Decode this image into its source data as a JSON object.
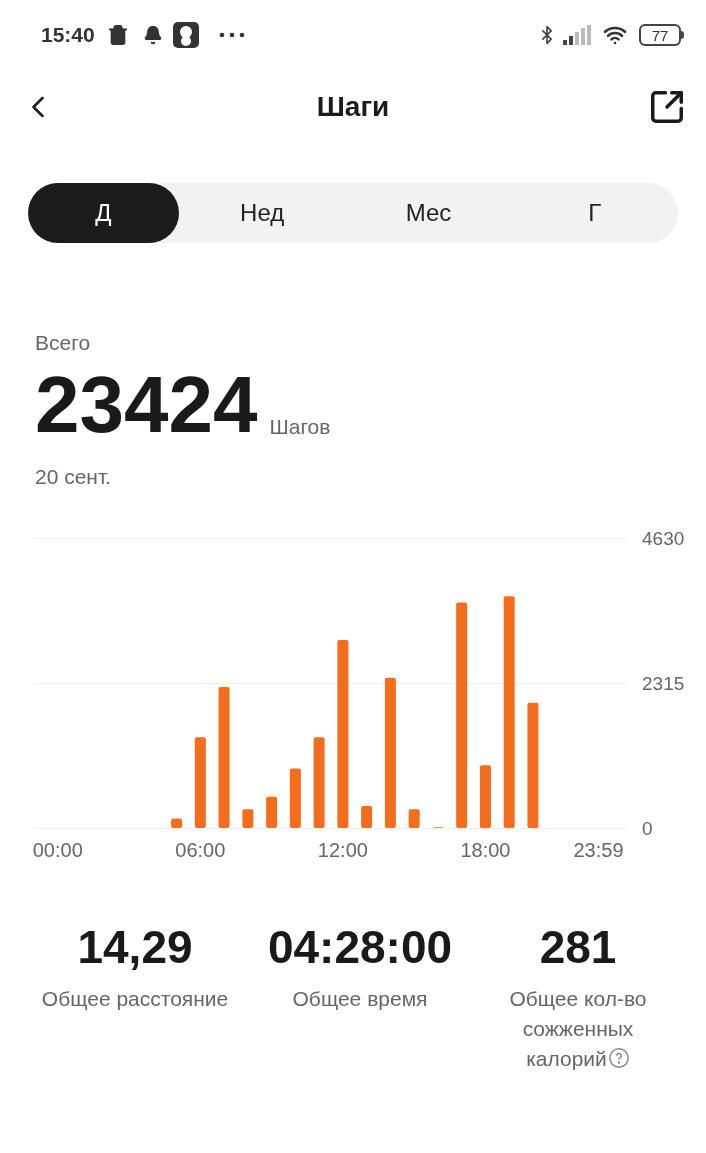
{
  "status_bar": {
    "time": "15:40",
    "battery": "77"
  },
  "header": {
    "title": "Шаги"
  },
  "tabs": [
    {
      "label": "Д",
      "selected": true
    },
    {
      "label": "Нед",
      "selected": false
    },
    {
      "label": "Мес",
      "selected": false
    },
    {
      "label": "Г",
      "selected": false
    }
  ],
  "summary": {
    "label": "Всего",
    "value": "23424",
    "unit": "Шагов",
    "date": "20 сент."
  },
  "chart": {
    "chart_data": {
      "type": "bar",
      "x": [
        5,
        6,
        7,
        8,
        9,
        10,
        11,
        12,
        13,
        14,
        15,
        16,
        17,
        18,
        19,
        20
      ],
      "xlim": [
        -1,
        24
      ],
      "series": [
        {
          "color": "#f36d1c",
          "values": [
            150,
            1450,
            2250,
            300,
            500,
            950,
            1450,
            3000,
            350,
            2400,
            300,
            10,
            3600,
            1000,
            3700,
            2000
          ]
        }
      ],
      "ylim": [
        0,
        4630
      ],
      "yticks": [
        0,
        2315,
        4630
      ],
      "xticks": [
        {
          "value": 0,
          "label": "00:00"
        },
        {
          "value": 6,
          "label": "06:00"
        },
        {
          "value": 12,
          "label": "12:00"
        },
        {
          "value": 18,
          "label": "18:00"
        },
        {
          "value": 23.98,
          "label": "23:59"
        }
      ]
    }
  },
  "stats": [
    {
      "value": "14,29",
      "label": "Общее расстояние",
      "info": false
    },
    {
      "value": "04:28:00",
      "label": "Общее время",
      "info": false
    },
    {
      "value": "281",
      "label": "Общее кол-во сожженных калорий",
      "info": true
    }
  ]
}
